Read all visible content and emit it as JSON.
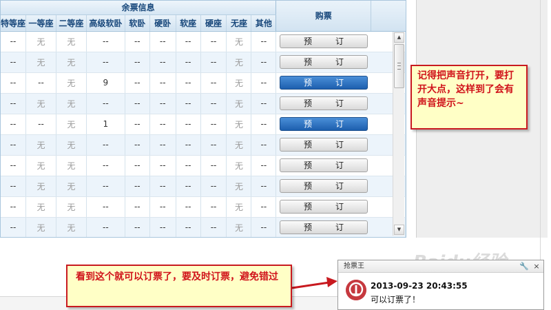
{
  "table": {
    "group_header": "余票信息",
    "buy_header": "购票",
    "columns": [
      "特等座",
      "一等座",
      "二等座",
      "高级软卧",
      "软卧",
      "硬卧",
      "软座",
      "硬座",
      "无座",
      "其他"
    ],
    "rows": [
      {
        "cells": [
          "--",
          "无",
          "无",
          "--",
          "--",
          "--",
          "--",
          "--",
          "无",
          "--"
        ],
        "button": "预订",
        "active": false
      },
      {
        "cells": [
          "--",
          "无",
          "无",
          "--",
          "--",
          "--",
          "--",
          "--",
          "无",
          "--"
        ],
        "button": "预订",
        "active": false
      },
      {
        "cells": [
          "--",
          "--",
          "无",
          "9",
          "--",
          "--",
          "--",
          "--",
          "无",
          "--"
        ],
        "button": "预订",
        "active": true
      },
      {
        "cells": [
          "--",
          "无",
          "无",
          "--",
          "--",
          "--",
          "--",
          "--",
          "无",
          "--"
        ],
        "button": "预订",
        "active": false
      },
      {
        "cells": [
          "--",
          "--",
          "无",
          "1",
          "--",
          "--",
          "--",
          "--",
          "无",
          "--"
        ],
        "button": "预订",
        "active": true
      },
      {
        "cells": [
          "--",
          "无",
          "无",
          "--",
          "--",
          "--",
          "--",
          "--",
          "无",
          "--"
        ],
        "button": "预订",
        "active": false
      },
      {
        "cells": [
          "--",
          "无",
          "无",
          "--",
          "--",
          "--",
          "--",
          "--",
          "无",
          "--"
        ],
        "button": "预订",
        "active": false
      },
      {
        "cells": [
          "--",
          "无",
          "无",
          "--",
          "--",
          "--",
          "--",
          "--",
          "无",
          "--"
        ],
        "button": "预订",
        "active": false
      },
      {
        "cells": [
          "--",
          "无",
          "无",
          "--",
          "--",
          "--",
          "--",
          "--",
          "无",
          "--"
        ],
        "button": "预订",
        "active": false
      },
      {
        "cells": [
          "--",
          "无",
          "无",
          "--",
          "--",
          "--",
          "--",
          "--",
          "无",
          "--"
        ],
        "button": "预订",
        "active": false
      }
    ]
  },
  "callouts": {
    "sound": "记得把声音打开，要打开大点，这样到了会有声音提示~",
    "notify": "看到这个就可以订票了，要及时订票，避免错过"
  },
  "notification": {
    "title": "抢票王",
    "wrench_icon": "wrench-icon",
    "close_icon": "close-icon",
    "time": "2013-09-23 20:43:55",
    "message": "可以订票了！",
    "close_glyph": "×",
    "wrench_glyph": "🔧"
  },
  "watermark": "Baidu经验",
  "colors": {
    "accent_blue": "#1d5fae",
    "callout_red": "#d0121a",
    "callout_bg": "#ffffc6"
  }
}
